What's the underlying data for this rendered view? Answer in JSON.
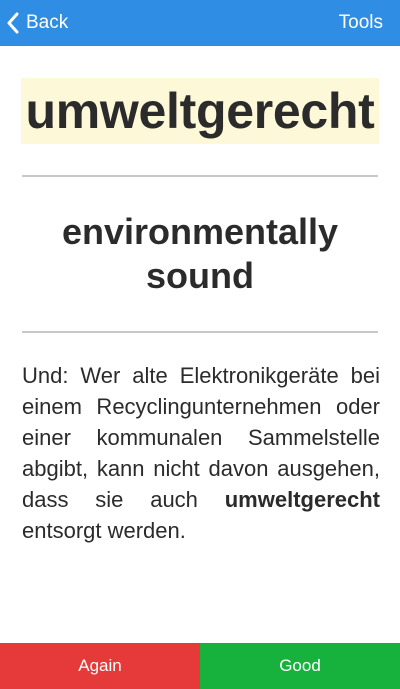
{
  "nav": {
    "back_label": "Back",
    "tools_label": "Tools"
  },
  "card": {
    "term": "umweltgerecht",
    "translation_line1": "environmentally",
    "translation_line2": "sound",
    "example_before": "Und: Wer alte Elektronikgeräte bei einem Recyclingun­ternehmen oder einer kommu­nalen Sammelstelle abgibt, kann nicht davon ausgehen, dass sie auch ",
    "example_highlight": "umweltgerecht",
    "example_after": " entsorgt werden."
  },
  "footer": {
    "again_label": "Again",
    "good_label": "Good"
  },
  "colors": {
    "nav_bg": "#2f8ee3",
    "term_highlight": "#fdf8d8",
    "again_bg": "#e63a3a",
    "good_bg": "#17b23e"
  }
}
